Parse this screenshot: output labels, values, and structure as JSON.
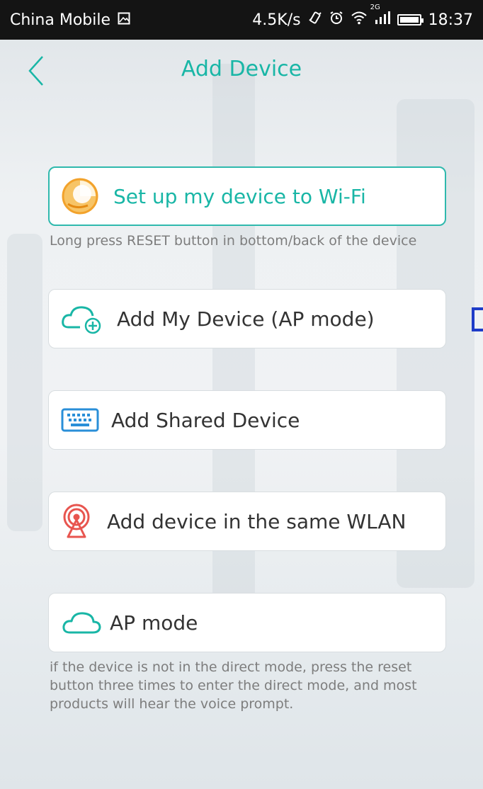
{
  "status_bar": {
    "carrier": "China Mobile",
    "speed": "4.5K/s",
    "network_badge": "2G",
    "time": "18:37",
    "icons": [
      "image-icon",
      "vibrate-icon",
      "alarm-icon",
      "wifi-icon",
      "signal-icon",
      "battery-icon"
    ]
  },
  "header": {
    "title": "Add Device",
    "back_icon": "chevron-left-icon"
  },
  "options": [
    {
      "label": "Set up my device to Wi-Fi",
      "icon": "smartconfig-icon",
      "hint": "Long press RESET button in bottom/back of the device"
    },
    {
      "label": "Add My Device (AP mode)",
      "icon": "cloud-add-icon"
    },
    {
      "label": "Add Shared Device",
      "icon": "keyboard-icon"
    },
    {
      "label": "Add device in the same WLAN",
      "icon": "broadcast-icon"
    },
    {
      "label": "AP mode",
      "icon": "cloud-icon",
      "hint": "if the device is not in the direct mode, press the reset button three times to enter the direct mode, and most products will hear the voice prompt."
    }
  ],
  "colors": {
    "accent": "#19b6a6",
    "status_bar": "#141414",
    "text": "#333333",
    "hint": "#7d7d7d",
    "broadcast_icon": "#e8554f",
    "keyboard_icon": "#2a8fd8",
    "smartconfig_icon": "#f2a22b"
  }
}
